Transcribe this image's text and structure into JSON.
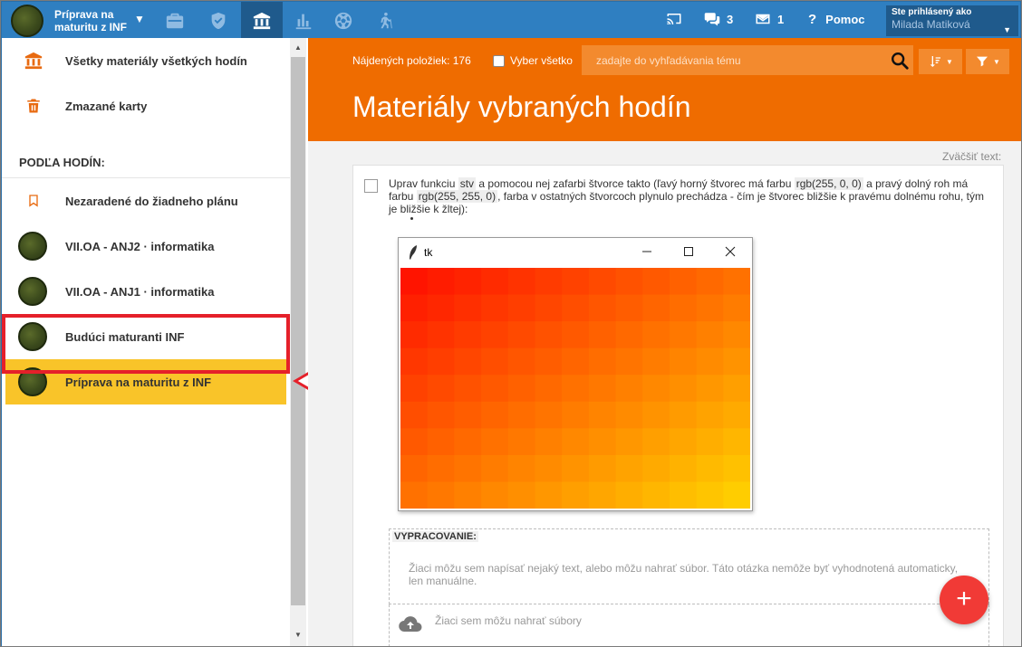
{
  "topbar": {
    "course_name": "Príprava na maturitu z INF",
    "nav_icons": [
      "briefcase-icon",
      "shield-check-icon",
      "library-icon",
      "bar-chart-icon",
      "ball-icon",
      "hiking-icon"
    ],
    "messages_count": "3",
    "mail_count": "1",
    "help_label": "Pomoc",
    "user_label": "Ste prihlásený ako",
    "user_name": "Milada Matiková",
    "accent": "#2f7fc1"
  },
  "sidebar": {
    "all_materials": "Všetky materiály všetkých hodín",
    "deleted_cards": "Zmazané karty",
    "section_heading": "PODĽA HODÍN:",
    "unassigned": "Nezaradené do žiadneho plánu",
    "classes": [
      {
        "label": "VII.OA - ANJ2 · informatika"
      },
      {
        "label": "VII.OA - ANJ1 · informatika"
      },
      {
        "label": "Budúci maturanti INF"
      },
      {
        "label": "Príprava na maturitu z INF",
        "active": true
      }
    ],
    "active_color": "#f9c429",
    "highlight_color": "#e5202a"
  },
  "header": {
    "found_count": "Nájdených položiek: 176",
    "select_all": "Vyber všetko",
    "search_placeholder": "zadajte do vyhľadávania tému",
    "title": "Materiály vybraných hodín",
    "accent": "#ef6c00"
  },
  "content": {
    "zoom_label": "Zväčšiť text:",
    "question": {
      "part1": "Uprav funkciu ",
      "code1": "stv",
      "part2": " a pomocou nej zafarbi štvorce takto (ľavý horný štvorec má farbu ",
      "code2": "rgb(255, 0, 0)",
      "part3": " a pravý dolný roh má farbu ",
      "code3": "rgb(255, 255, 0)",
      "part4": ", farba v ostatných štvorcoch plynulo prechádza - čím je štvorec bližšie k pravému dolnému rohu, tým je bližšie k žltej):"
    },
    "tk_window": {
      "title": "tk",
      "grid_cols": 13,
      "grid_rows": 9,
      "start_color": "rgb(255, 0, 0)",
      "end_color": "rgb(255, 255, 0)"
    },
    "answer_heading": "VYPRACOVANIE:",
    "answer_placeholder": "Žiaci môžu sem napísať nejaký text, alebo môžu nahrať súbor. Táto otázka nemôže byť vyhodnotená automaticky, len manuálne.",
    "upload_label": "Žiaci sem môžu nahrať súbory",
    "fab_label": "+"
  }
}
